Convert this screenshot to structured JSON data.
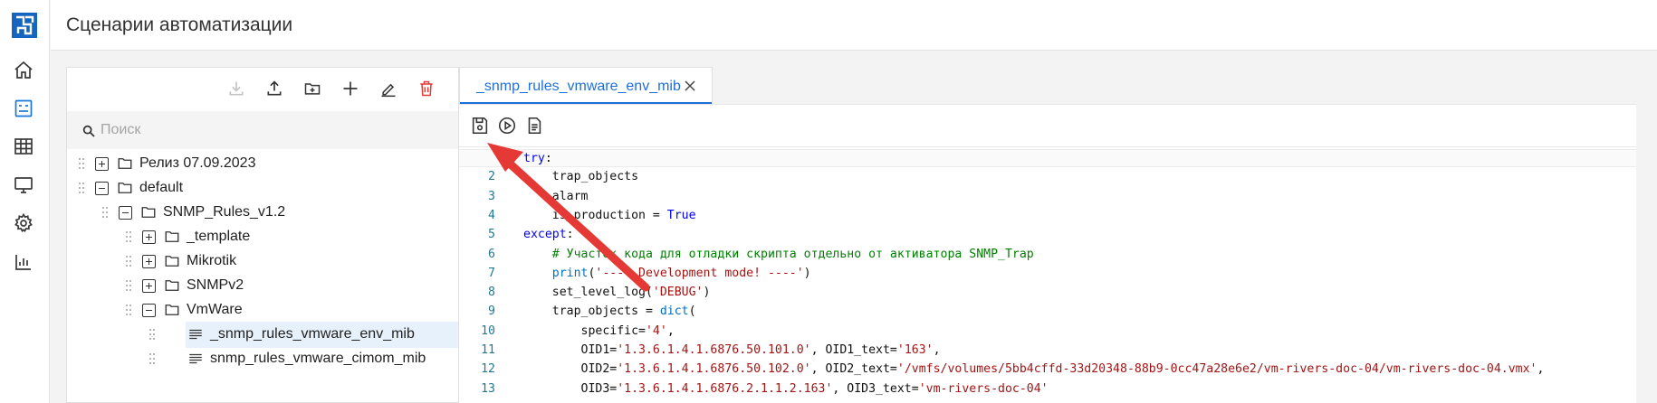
{
  "app": {
    "page_title": "Сценарии автоматизации",
    "brand_color": "#1565c0"
  },
  "nav_rail": {
    "items": [
      {
        "icon": "home-icon",
        "active": false
      },
      {
        "icon": "scenarios-icon",
        "active": true
      },
      {
        "icon": "table-icon",
        "active": false
      },
      {
        "icon": "monitor-icon",
        "active": false
      },
      {
        "icon": "gear-icon",
        "active": false
      },
      {
        "icon": "chart-icon",
        "active": false
      }
    ]
  },
  "tree": {
    "toolbar": [
      {
        "icon": "download-icon",
        "disabled": true
      },
      {
        "icon": "upload-icon",
        "disabled": false
      },
      {
        "icon": "new-folder-icon",
        "disabled": false
      },
      {
        "icon": "add-icon",
        "disabled": false
      },
      {
        "icon": "edit-icon",
        "disabled": false
      },
      {
        "icon": "delete-icon",
        "disabled": false
      }
    ],
    "search_placeholder": "Поиск",
    "rows": [
      {
        "label": "Релиз 07.09.2023",
        "type": "folder",
        "state": "collapsed",
        "level": 0
      },
      {
        "label": "default",
        "type": "folder",
        "state": "expanded",
        "level": 0
      },
      {
        "label": "SNMP_Rules_v1.2",
        "type": "folder",
        "state": "expanded",
        "level": 1
      },
      {
        "label": "_template",
        "type": "folder",
        "state": "collapsed",
        "level": 2
      },
      {
        "label": "Mikrotik",
        "type": "folder",
        "state": "collapsed",
        "level": 2
      },
      {
        "label": "SNMPv2",
        "type": "folder",
        "state": "collapsed",
        "level": 2
      },
      {
        "label": "VmWare",
        "type": "folder",
        "state": "expanded",
        "level": 2
      },
      {
        "label": "_snmp_rules_vmware_env_mib",
        "type": "file",
        "selected": true,
        "level": 3
      },
      {
        "label": "snmp_rules_vmware_cimom_mib",
        "type": "file",
        "selected": false,
        "level": 3
      }
    ]
  },
  "editor": {
    "tab_label": "_snmp_rules_vmware_env_mib",
    "toolbar": [
      {
        "icon": "save-icon"
      },
      {
        "icon": "run-icon"
      },
      {
        "icon": "document-icon"
      }
    ],
    "lines": [
      {
        "n": "",
        "active": true,
        "parts": [
          {
            "t": "try",
            "c": "kw"
          },
          {
            "t": ":"
          }
        ]
      },
      {
        "n": "2",
        "parts": [
          {
            "t": "    trap_objects"
          }
        ]
      },
      {
        "n": "3",
        "parts": [
          {
            "t": "    alarm"
          }
        ]
      },
      {
        "n": "4",
        "parts": [
          {
            "t": "    is_production = "
          },
          {
            "t": "True",
            "c": "bool"
          }
        ]
      },
      {
        "n": "5",
        "parts": [
          {
            "t": "except",
            "c": "kw"
          },
          {
            "t": ":"
          }
        ]
      },
      {
        "n": "6",
        "parts": [
          {
            "t": "    "
          },
          {
            "t": "# Участок кода для отладки скрипта отдельно от активатора SNMP_Trap",
            "c": "cmt"
          }
        ]
      },
      {
        "n": "7",
        "parts": [
          {
            "t": "    "
          },
          {
            "t": "print",
            "c": "bi"
          },
          {
            "t": "("
          },
          {
            "t": "'---- Development mode! ----'",
            "c": "str"
          },
          {
            "t": ")"
          }
        ]
      },
      {
        "n": "8",
        "parts": [
          {
            "t": "    set_level_log("
          },
          {
            "t": "'DEBUG'",
            "c": "str"
          },
          {
            "t": ")"
          }
        ]
      },
      {
        "n": "9",
        "parts": [
          {
            "t": "    trap_objects = "
          },
          {
            "t": "dict",
            "c": "bi"
          },
          {
            "t": "("
          }
        ]
      },
      {
        "n": "10",
        "parts": [
          {
            "t": "        specific="
          },
          {
            "t": "'4'",
            "c": "str"
          },
          {
            "t": ","
          }
        ]
      },
      {
        "n": "11",
        "parts": [
          {
            "t": "        OID1="
          },
          {
            "t": "'1.3.6.1.4.1.6876.50.101.0'",
            "c": "str"
          },
          {
            "t": ", OID1_text="
          },
          {
            "t": "'163'",
            "c": "str"
          },
          {
            "t": ","
          }
        ]
      },
      {
        "n": "12",
        "parts": [
          {
            "t": "        OID2="
          },
          {
            "t": "'1.3.6.1.4.1.6876.50.102.0'",
            "c": "str"
          },
          {
            "t": ", OID2_text="
          },
          {
            "t": "'/vmfs/volumes/5bb4cffd-33d20348-88b9-0cc47a28e6e2/vm-rivers-doc-04/vm-rivers-doc-04.vmx'",
            "c": "str"
          },
          {
            "t": ","
          }
        ]
      },
      {
        "n": "13",
        "parts": [
          {
            "t": "        OID3="
          },
          {
            "t": "'1.3.6.1.4.1.6876.2.1.1.2.163'",
            "c": "str"
          },
          {
            "t": ", OID3_text="
          },
          {
            "t": "'vm-rivers-doc-04'",
            "c": "str"
          }
        ]
      }
    ]
  },
  "annotation_arrow": {
    "color": "#e53935"
  }
}
